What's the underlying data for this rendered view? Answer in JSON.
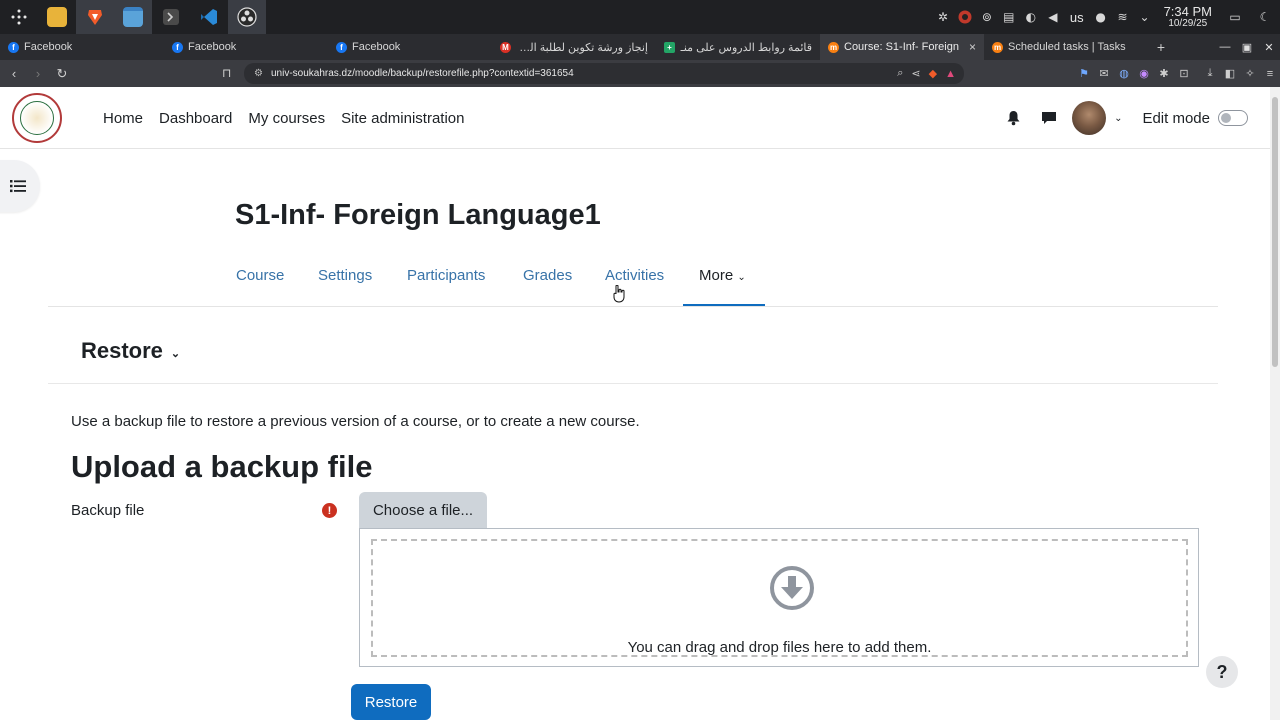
{
  "taskbar": {
    "apps": [
      {
        "name": "launcher-icon",
        "color": "#1f2023"
      },
      {
        "name": "file-manager-icon",
        "color": "#e8b33a"
      },
      {
        "name": "brave-browser-icon",
        "color": "#f25c2a"
      },
      {
        "name": "files-icon",
        "color": "#5aa3d9"
      },
      {
        "name": "terminal-icon",
        "color": "#4a4a4a"
      },
      {
        "name": "vscode-icon",
        "color": "#2a8ad8"
      },
      {
        "name": "obs-icon",
        "color": "#dddddd"
      }
    ],
    "tray_lang": "us",
    "clock_time": "7:34 PM",
    "clock_date": "10/29/25"
  },
  "tabs": [
    {
      "title": "Facebook",
      "fav_color": "#1877f2",
      "fav_letter": "f"
    },
    {
      "title": "Facebook",
      "fav_color": "#1877f2",
      "fav_letter": "f"
    },
    {
      "title": "Facebook",
      "fav_color": "#1877f2",
      "fav_letter": "f"
    },
    {
      "title": "إنجاز ورشة تكوين لطلبة الدكت",
      "fav_color": "#d93025",
      "fav_letter": "M"
    },
    {
      "title": "قائمة روابط الدروس على منـ",
      "fav_color": "#23a566",
      "fav_letter": "+"
    },
    {
      "title": "Course: S1-Inf- Foreign",
      "fav_color": "#f98012",
      "fav_letter": "m",
      "active": true
    },
    {
      "title": "Scheduled tasks | Tasks",
      "fav_color": "#f98012",
      "fav_letter": "m"
    }
  ],
  "address": {
    "url": "univ-soukahras.dz/moodle/backup/restorefile.php?contextid=361654"
  },
  "nav": {
    "home": "Home",
    "dashboard": "Dashboard",
    "my_courses": "My courses",
    "site_admin": "Site administration",
    "edit_mode": "Edit mode"
  },
  "course": {
    "title": "S1-Inf- Foreign Language1"
  },
  "secondary_nav": {
    "course": "Course",
    "settings": "Settings",
    "participants": "Participants",
    "grades": "Grades",
    "activities": "Activities",
    "more": "More"
  },
  "restore": {
    "heading": "Restore",
    "description": "Use a backup file to restore a previous version of a course, or to create a new course.",
    "upload_heading": "Upload a backup file",
    "backup_label": "Backup file",
    "choose_label": "Choose a file...",
    "drop_text": "You can drag and drop files here to add them.",
    "restore_button": "Restore",
    "help": "?"
  },
  "colors": {
    "link": "#3873a8",
    "primary": "#0f6cbf",
    "danger": "#ca3120"
  }
}
